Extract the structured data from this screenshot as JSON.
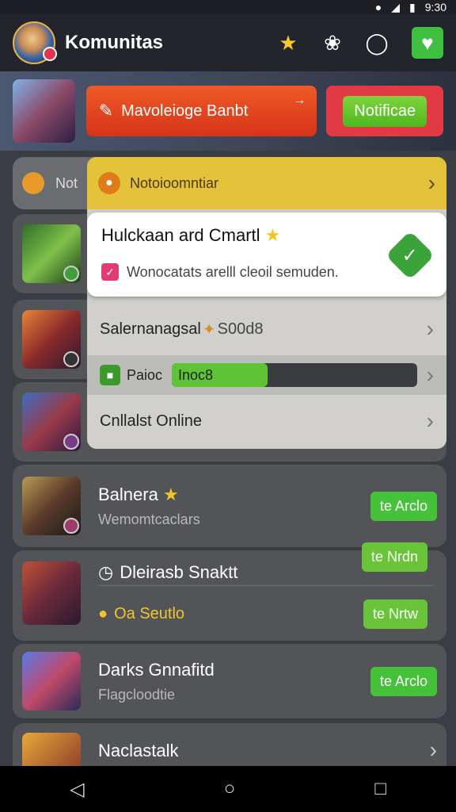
{
  "status_bar": {
    "time": "9:30"
  },
  "app_bar": {
    "title": "Komunitas"
  },
  "banner": {
    "button_label": "Mavoleioge Banbt",
    "notification_label": "Notificae"
  },
  "partial_card": {
    "label": "Not"
  },
  "overlay": {
    "header_label": "Notoioomntiar",
    "popup_title": "Hulckaan ard Cmartl",
    "popup_subtitle": "Wonocatats arelll cleoil semuden.",
    "row1_label": "Salernanagsal",
    "row1_value": "S00d8",
    "row2_label": "Paioc",
    "progress_label": "Inoc8",
    "progress_fraction": 0.39,
    "row3_label": "Cnllalst Online"
  },
  "list": [
    {
      "title": "Balnera",
      "subtitle": "Wemomtcaclars",
      "action": "te Arclo"
    },
    {
      "title": "Dleirasb Snaktt",
      "subtitle": "Oa Seutlo",
      "action": "te Nrdn",
      "action2": "te Nrtw"
    },
    {
      "title": "Darks Gnnafitd",
      "subtitle": "Flagcloodtie",
      "action": "te Arclo"
    },
    {
      "title": "Naclastalk"
    }
  ],
  "colors": {
    "accent_green": "#46c23a",
    "accent_red": "#e23a45",
    "accent_yellow": "#e4c23a"
  }
}
